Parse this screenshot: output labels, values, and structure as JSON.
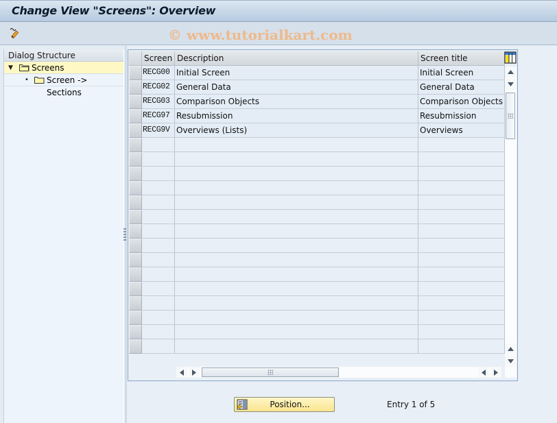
{
  "window": {
    "title": "Change View \"Screens\": Overview",
    "watermark": "© www.tutorialkart.com"
  },
  "toolbar": {
    "buttons": [
      {
        "icon": "display-change-icon",
        "tooltip": ""
      }
    ]
  },
  "dialog_structure": {
    "header": "Dialog Structure",
    "items": [
      {
        "label": "Screens",
        "level": 0,
        "expanded": true,
        "selected": true,
        "icon": "folder-open-icon"
      },
      {
        "label": "Screen -> Sections",
        "level": 1,
        "expanded": false,
        "selected": false,
        "icon": "folder-icon"
      }
    ]
  },
  "table": {
    "columns": [
      {
        "key": "screen",
        "label": "Screen"
      },
      {
        "key": "description",
        "label": "Description"
      },
      {
        "key": "screen_title",
        "label": "Screen title"
      }
    ],
    "rows": [
      {
        "screen": "RECG00",
        "description": "Initial Screen",
        "screen_title": "Initial Screen"
      },
      {
        "screen": "RECG02",
        "description": "General Data",
        "screen_title": "General Data"
      },
      {
        "screen": "RECG03",
        "description": "Comparison Objects",
        "screen_title": "Comparison Objects"
      },
      {
        "screen": "RECG97",
        "description": "Resubmission",
        "screen_title": "Resubmission"
      },
      {
        "screen": "RECG9V",
        "description": "Overviews (Lists)",
        "screen_title": "Overviews"
      }
    ],
    "visible_row_count": 20
  },
  "footer": {
    "position_button": "Position...",
    "entry_info": "Entry 1 of 5"
  },
  "colors": {
    "selected_tree_row": "#fdf8c4",
    "position_button": "#f9e58e",
    "watermark": "#efb98a"
  }
}
